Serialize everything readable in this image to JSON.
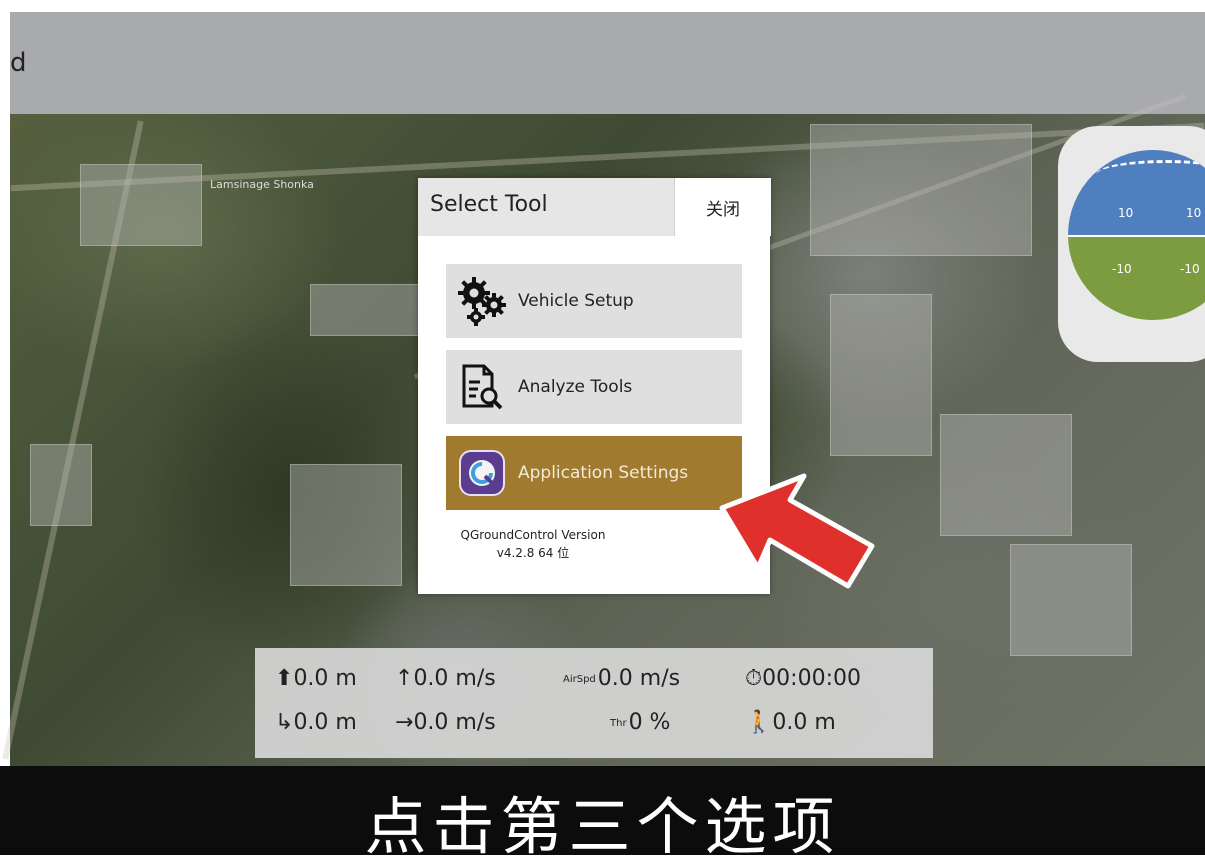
{
  "window": {
    "title_fragment": "d"
  },
  "map": {
    "place_label": "Lamsinage Shonka"
  },
  "attitude": {
    "pitch_labels": [
      "10",
      "10",
      "-10",
      "-10"
    ]
  },
  "dialog": {
    "title": "Select Tool",
    "close_label": "关闭",
    "tools": [
      {
        "label": "Vehicle Setup",
        "icon": "gears-icon"
      },
      {
        "label": "Analyze Tools",
        "icon": "analyze-document-icon"
      },
      {
        "label": "Application Settings",
        "icon": "qgc-logo-icon",
        "selected": true
      }
    ],
    "version_line1": "QGroundControl Version",
    "version_line2": "v4.2.8 64 位"
  },
  "telemetry": {
    "altitude": "0.0 m",
    "vertical_speed": "0.0 m/s",
    "airspeed_label": "AirSpd",
    "airspeed": "0.0 m/s",
    "flight_time": "00:00:00",
    "distance_home": "0.0 m",
    "ground_speed": "0.0 m/s",
    "throttle_label": "Thr",
    "throttle": "0 %",
    "distance": "0.0 m"
  },
  "subtitle": "点击第三个选项",
  "colors": {
    "selected_tool": "#a07a2e",
    "arrow": "#e0302b",
    "sky": "#4f7fbf",
    "ground": "#7d9b3f"
  }
}
